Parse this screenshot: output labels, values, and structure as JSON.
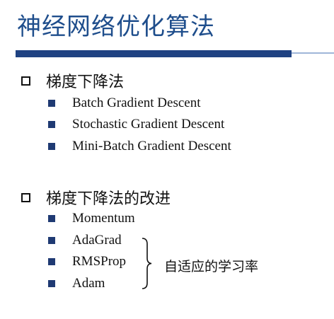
{
  "slide": {
    "title": "神经网络优化算法"
  },
  "sections": [
    {
      "heading": "梯度下降法",
      "items": [
        "Batch Gradient Descent",
        "Stochastic Gradient Descent",
        "Mini-Batch Gradient Descent"
      ]
    },
    {
      "heading": "梯度下降法的改进",
      "items": [
        "Momentum",
        "AdaGrad",
        "RMSProp",
        "Adam"
      ]
    }
  ],
  "brace_note": "自适应的学习率",
  "colors": {
    "title": "#1f4e8c",
    "rule": "#1f4282",
    "bullet": "#1f3a73"
  }
}
